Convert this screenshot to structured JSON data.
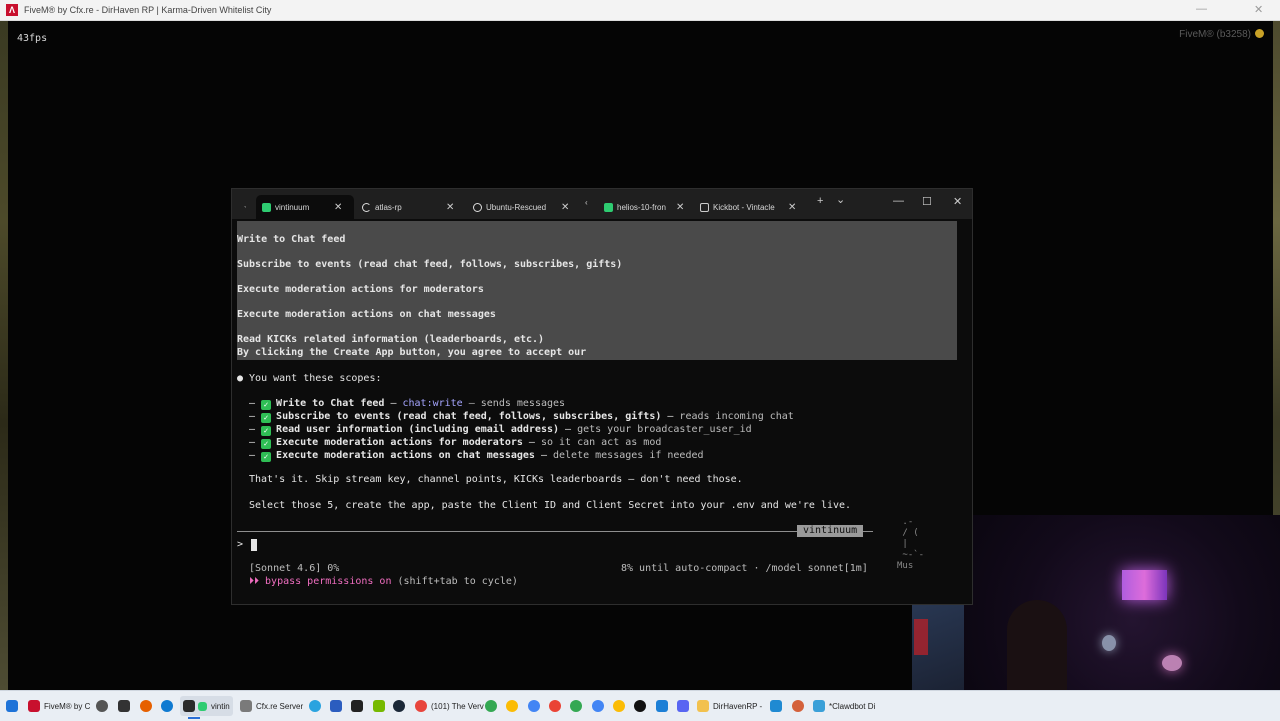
{
  "fivem": {
    "title": "FiveM® by Cfx.re - DirHaven RP | Karma-Driven Whitelist City",
    "fps": "43fps",
    "build": "FiveM® (b3258)",
    "minimize": "—",
    "close": "✕"
  },
  "terminal": {
    "tabs": [
      {
        "label": "vintinuum",
        "active": true,
        "icon": "green-square-icon"
      },
      {
        "label": "atlas-rp",
        "active": false,
        "icon": "spinner-icon"
      },
      {
        "label": "Ubuntu-Rescued",
        "active": false,
        "icon": "ubuntu-icon"
      },
      {
        "label": "helios-10-fron",
        "active": false,
        "icon": "green-square-icon"
      },
      {
        "label": "Kickbot - Vintacle",
        "active": false,
        "icon": "cmd-icon"
      }
    ],
    "new_tab": "+",
    "tab_dropdown": "⌄",
    "tab_close": "✕",
    "win_minimize": "—",
    "win_maximize": "☐",
    "win_close": "✕",
    "selected_lines": [
      "Write to Chat feed",
      "Subscribe to events (read chat feed, follows, subscribes, gifts)",
      "Execute moderation actions for moderators",
      "Execute moderation actions on chat messages",
      "Read KICKs related information (leaderboards, etc.)",
      "By clicking the Create App button, you agree to accept our"
    ],
    "scopes_header": "● You want these scopes:",
    "scopes": [
      {
        "name": "Write to Chat feed",
        "sep": " — ",
        "code": "chat:write",
        "desc": " — sends messages"
      },
      {
        "name": "Subscribe to events (read chat feed, follows, subscribes, gifts)",
        "sep": " — ",
        "code": "",
        "desc": "reads incoming chat"
      },
      {
        "name": "Read user information (including email address)",
        "sep": " — ",
        "code": "",
        "desc": "gets your broadcaster_user_id"
      },
      {
        "name": "Execute moderation actions for moderators",
        "sep": " — ",
        "code": "",
        "desc": "so it can act as mod"
      },
      {
        "name": "Execute moderation actions on chat messages",
        "sep": " — ",
        "code": "",
        "desc": "delete messages if needed"
      }
    ],
    "skip_line": "That's it. Skip stream key, channel points, KICKs leaderboards — don't need those.",
    "final_line": "Select those 5, create the app, paste the Client ID and Client Secret into your .env and we're live.",
    "session_tag": "vintinuum",
    "prompt_symbol": ">",
    "status_left": "[Sonnet 4.6] 0%",
    "status_right": "8% until auto-compact · /model sonnet[1m]",
    "bypass_prefix": "⏵⏵ ",
    "bypass_label": "bypass permissions on",
    "bypass_hint": " (shift+tab to cycle)",
    "side_fragment": " .-\n / (\n |\n ~-`-\nMus"
  },
  "taskbar": {
    "items": [
      {
        "label": "",
        "icon": "windows-start-icon",
        "color": "#1e73d8"
      },
      {
        "label": "FiveM® by C",
        "icon": "fivem-icon",
        "color": "#c8102e"
      },
      {
        "label": "",
        "icon": "settings-icon",
        "color": "#555555"
      },
      {
        "label": "",
        "icon": "gamepad-icon",
        "color": "#333333"
      },
      {
        "label": "",
        "icon": "browser-icon",
        "color": "#e66000"
      },
      {
        "label": "",
        "icon": "edge-icon",
        "color": "#0f7ad1"
      },
      {
        "label": "vintin",
        "icon": "terminal-icon",
        "color": "#2a2a2a"
      },
      {
        "label": "Cfx.re Server",
        "icon": "cfx-icon",
        "color": "#7a7a7a"
      },
      {
        "label": "",
        "icon": "telegram-icon",
        "color": "#2aa3df"
      },
      {
        "label": "",
        "icon": "app-icon",
        "color": "#2b5dbf"
      },
      {
        "label": "",
        "icon": "cmd-icon",
        "color": "#222222"
      },
      {
        "label": "",
        "icon": "nvidia-icon",
        "color": "#76b900"
      },
      {
        "label": "",
        "icon": "steam-icon",
        "color": "#1b2838"
      },
      {
        "label": "(101) The Verv",
        "icon": "chrome-icon",
        "color": "#e8453c"
      },
      {
        "label": "",
        "icon": "chrome-icon",
        "color": "#34a853"
      },
      {
        "label": "",
        "icon": "chrome-icon",
        "color": "#fbbc05"
      },
      {
        "label": "",
        "icon": "chrome-icon",
        "color": "#4285f4"
      },
      {
        "label": "",
        "icon": "chrome-icon",
        "color": "#ea4335"
      },
      {
        "label": "",
        "icon": "chrome-icon",
        "color": "#34a853"
      },
      {
        "label": "",
        "icon": "openai-icon",
        "color": "#111111"
      },
      {
        "label": "",
        "icon": "app-icon",
        "color": "#1c7fd6"
      },
      {
        "label": "",
        "icon": "discord-icon",
        "color": "#5865f2"
      },
      {
        "label": "DirHavenRP -",
        "icon": "folder-icon",
        "color": "#f2c14e"
      },
      {
        "label": "",
        "icon": "vscode-icon",
        "color": "#1f8ad2"
      },
      {
        "label": "",
        "icon": "claude-icon",
        "color": "#d4613b"
      },
      {
        "label": "*Clawdbot Di",
        "icon": "notepad-icon",
        "color": "#3aa0d8"
      }
    ]
  }
}
